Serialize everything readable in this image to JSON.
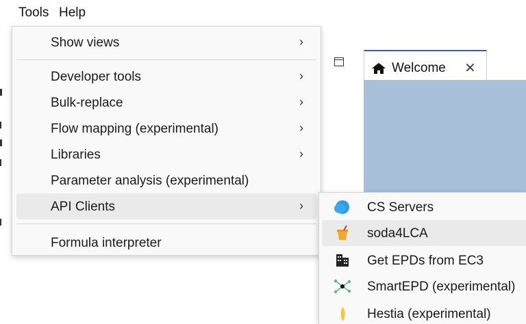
{
  "menubar": {
    "items": [
      "Tools",
      "Help"
    ]
  },
  "tab": {
    "label": "Welcome",
    "close_glyph": "✕",
    "icon": "home-icon"
  },
  "tools_menu": {
    "arrow_glyph": "›",
    "items": [
      {
        "label": "Show views",
        "has_submenu": true
      },
      {
        "label": "Developer tools",
        "has_submenu": true
      },
      {
        "label": "Bulk-replace",
        "has_submenu": true
      },
      {
        "label": "Flow mapping (experimental)",
        "has_submenu": true
      },
      {
        "label": "Libraries",
        "has_submenu": true
      },
      {
        "label": "Parameter analysis (experimental)",
        "has_submenu": false
      },
      {
        "label": "API Clients",
        "has_submenu": true,
        "active": true
      },
      {
        "label": "Formula interpreter",
        "has_submenu": false
      }
    ]
  },
  "api_clients_submenu": {
    "items": [
      {
        "label": "CS Servers",
        "icon": "cloud-icon"
      },
      {
        "label": "soda4LCA",
        "icon": "soda-icon",
        "active": true
      },
      {
        "label": "Get EPDs from EC3",
        "icon": "buildings-icon"
      },
      {
        "label": "SmartEPD (experimental)",
        "icon": "network-icon"
      },
      {
        "label": "Hestia (experimental)",
        "icon": "leaf-icon"
      }
    ]
  },
  "colors": {
    "menu_bg": "#f9f9f9",
    "active_item_bg": "#eaeaea",
    "tab_accent": "#3a5fa8",
    "welcome_bg": "#a8bfd8",
    "cloud_icon": "#2f9be6",
    "soda_icon": "#f0a830",
    "leaf_icon": "#f5c542"
  }
}
